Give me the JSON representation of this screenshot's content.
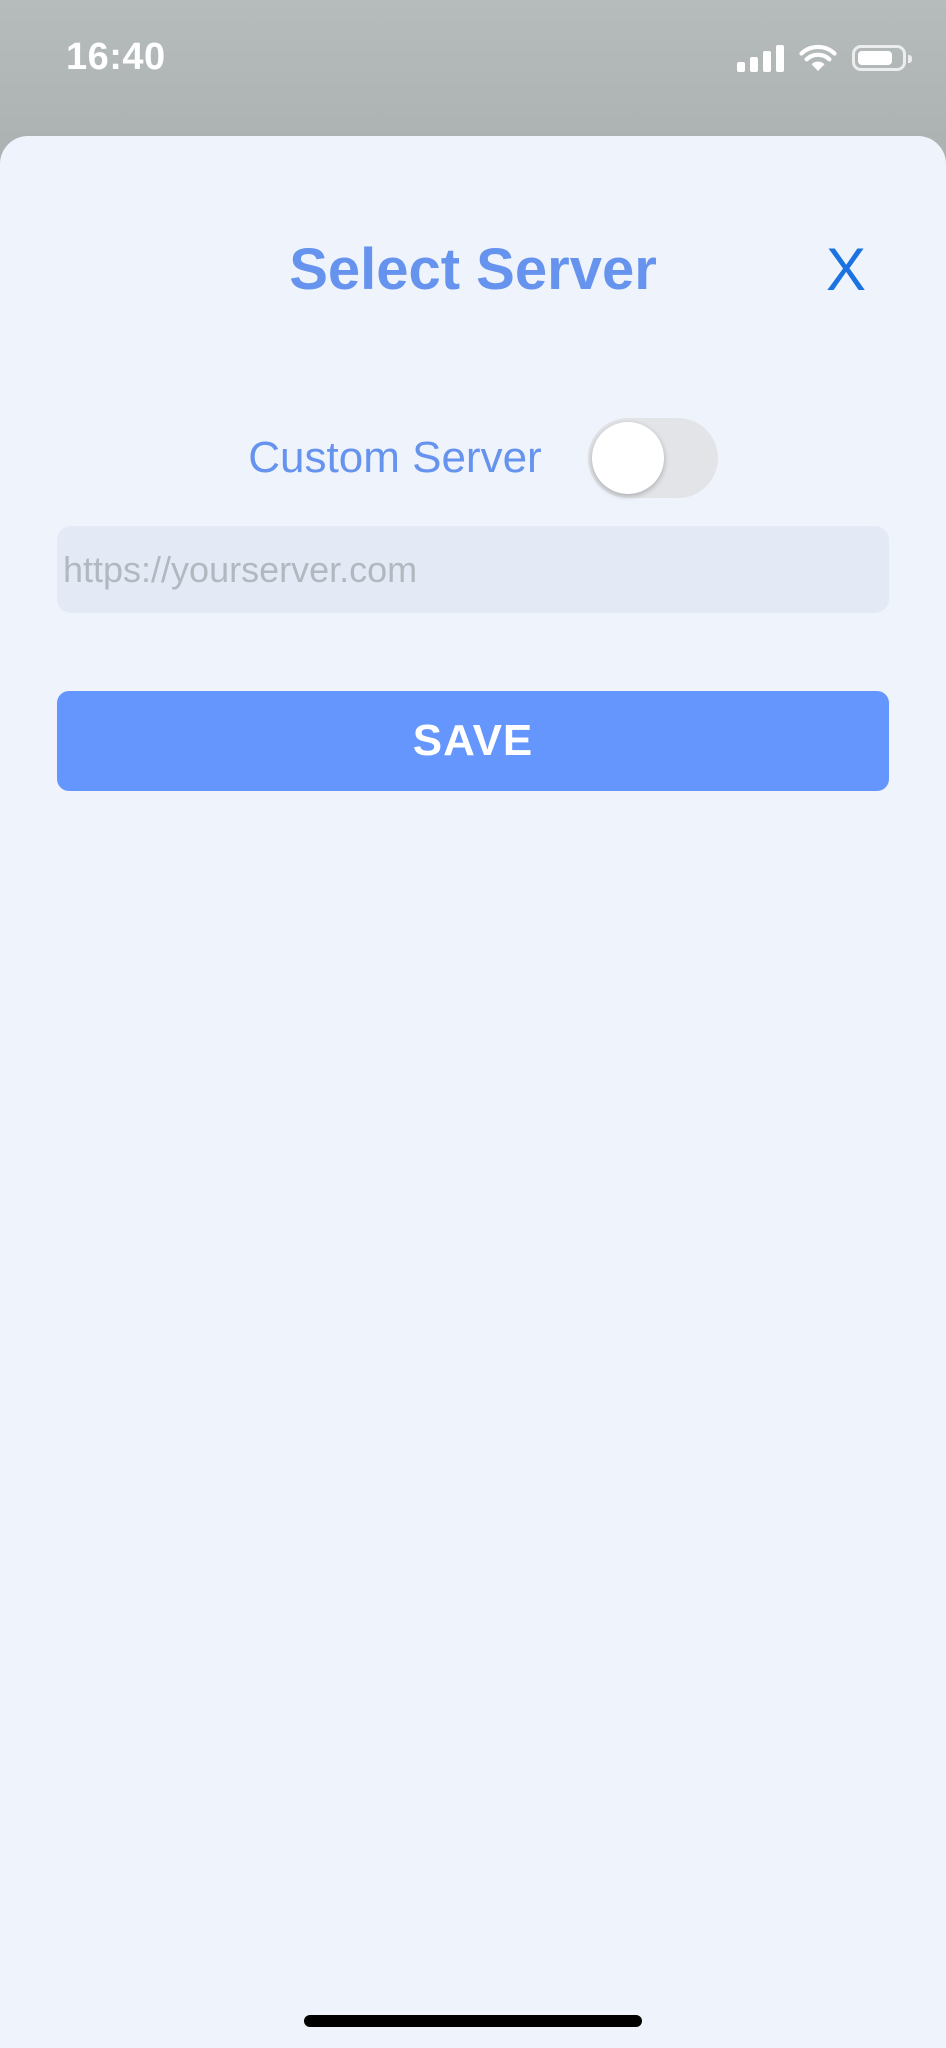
{
  "status_bar": {
    "time": "16:40",
    "battery_level": 0.8,
    "icons": [
      "cellular-signal-icon",
      "wifi-icon",
      "battery-icon"
    ]
  },
  "sheet": {
    "title": "Select Server",
    "close_label": "X"
  },
  "custom_server": {
    "label": "Custom Server",
    "enabled": false
  },
  "server_url": {
    "value": "",
    "placeholder": "https://yourserver.com"
  },
  "save_button": {
    "label": "SAVE"
  },
  "colors": {
    "accent": "#6593ee",
    "close": "#1a73e0",
    "button": "#6496fd",
    "sheet_background": "#eff3fb",
    "input_background": "#e3eaf5"
  }
}
